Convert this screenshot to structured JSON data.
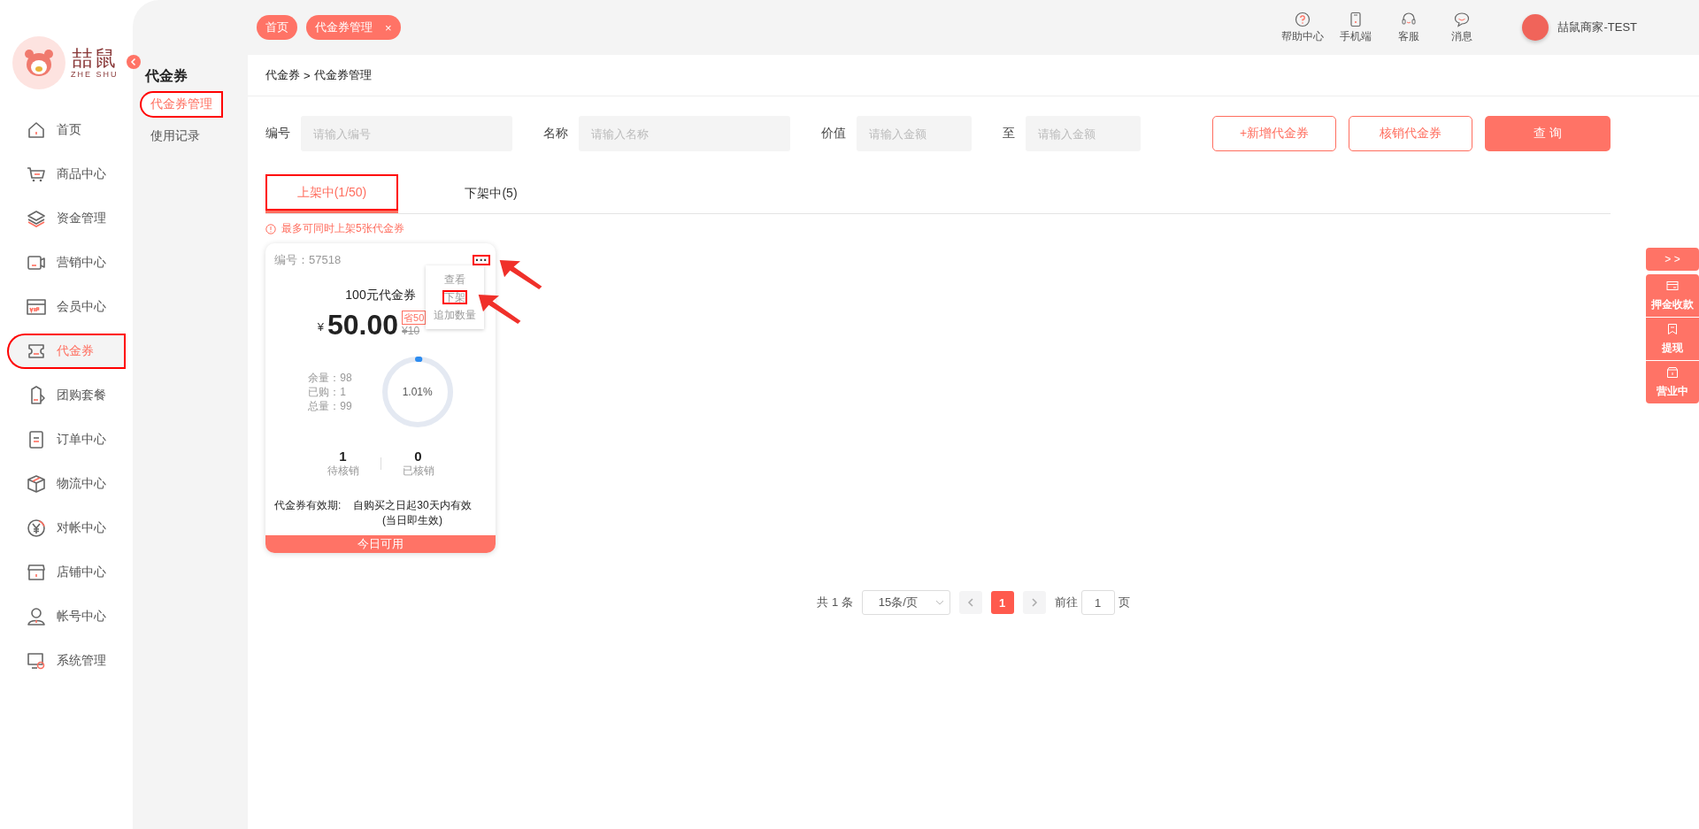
{
  "logo": {
    "name": "喆鼠",
    "subtitle": "ZHE SHU"
  },
  "sidebar": {
    "items": [
      {
        "label": "首页",
        "selected": false,
        "highlighted": false
      },
      {
        "label": "商品中心",
        "selected": false,
        "highlighted": false
      },
      {
        "label": "资金管理",
        "selected": false,
        "highlighted": false
      },
      {
        "label": "营销中心",
        "selected": false,
        "highlighted": false
      },
      {
        "label": "会员中心",
        "selected": false,
        "highlighted": false
      },
      {
        "label": "代金券",
        "selected": true,
        "highlighted": true
      },
      {
        "label": "团购套餐",
        "selected": false,
        "highlighted": false
      },
      {
        "label": "订单中心",
        "selected": false,
        "highlighted": false
      },
      {
        "label": "物流中心",
        "selected": false,
        "highlighted": false
      },
      {
        "label": "对帐中心",
        "selected": false,
        "highlighted": false
      },
      {
        "label": "店铺中心",
        "selected": false,
        "highlighted": false
      },
      {
        "label": "帐号中心",
        "selected": false,
        "highlighted": false
      },
      {
        "label": "系统管理",
        "selected": false,
        "highlighted": false
      }
    ]
  },
  "submenu": {
    "title": "代金券",
    "items": [
      {
        "label": "代金券管理",
        "selected": true,
        "highlighted": true
      },
      {
        "label": "使用记录",
        "selected": false,
        "highlighted": false
      }
    ]
  },
  "topbar": {
    "tabs": [
      {
        "label": "首页",
        "closable": false
      },
      {
        "label": "代金券管理",
        "closable": true,
        "close": "×"
      }
    ],
    "tools": [
      {
        "label": "帮助中心"
      },
      {
        "label": "手机端"
      },
      {
        "label": "客服"
      },
      {
        "label": "消息"
      }
    ],
    "user": {
      "name": "喆鼠商家-TEST"
    }
  },
  "breadcrumb": {
    "items": [
      "代金券",
      "代金券管理"
    ],
    "separator": ">"
  },
  "filters": [
    {
      "label": "编号",
      "placeholder": "请输入编号",
      "kind": "wide"
    },
    {
      "label": "名称",
      "placeholder": "请输入名称",
      "kind": "wide"
    },
    {
      "label": "价值",
      "placeholder": "请输入金额",
      "kind": "narrow"
    },
    {
      "label": "至",
      "placeholder": "请输入金额",
      "kind": "narrow"
    }
  ],
  "buttons": [
    {
      "label": "+新增代金券",
      "kind": "outline"
    },
    {
      "label": "核销代金券",
      "kind": "outline"
    },
    {
      "label": "查 询",
      "kind": "primary"
    }
  ],
  "tabs": [
    {
      "label": "上架中(1/50)",
      "selected": true,
      "highlighted": true
    },
    {
      "label": "下架中(5)",
      "selected": false,
      "highlighted": false
    }
  ],
  "notice": "最多可同时上架5张代金券",
  "cards": [
    {
      "code": "编号：57518",
      "more": "···",
      "more_highlighted": true,
      "title": "100元代金券",
      "currency": "¥",
      "price": "50.00",
      "save_tag": "省50",
      "original_price": "¥10",
      "stats": [
        "余量：98",
        "已购：1",
        "总量：99"
      ],
      "progress": {
        "level": 0.0101,
        "label": "1.01%"
      },
      "counts": [
        {
          "value": "1",
          "label": "待核销"
        },
        {
          "value": "0",
          "label": "已核销"
        }
      ],
      "validity": {
        "label": "代金券有效期:",
        "text": "自购买之日起30天内有效",
        "note": "(当日即生效)"
      },
      "footer": "今日可用",
      "menu": {
        "open": true,
        "items": [
          {
            "label": "查看",
            "highlighted": false
          },
          {
            "label": "下架",
            "highlighted": true
          },
          {
            "label": "追加数量",
            "highlighted": false
          }
        ]
      }
    }
  ],
  "pagination": {
    "total": "共 1 条",
    "page_size": "15条/页",
    "pages": [
      {
        "label": "1",
        "selected": true
      }
    ],
    "goto_label": "前往",
    "goto_value": "1",
    "page_unit": "页"
  },
  "dock": {
    "toggle": "> >",
    "items": [
      {
        "label": "押金收款"
      },
      {
        "label": "提现"
      },
      {
        "label": "营业中"
      }
    ]
  }
}
